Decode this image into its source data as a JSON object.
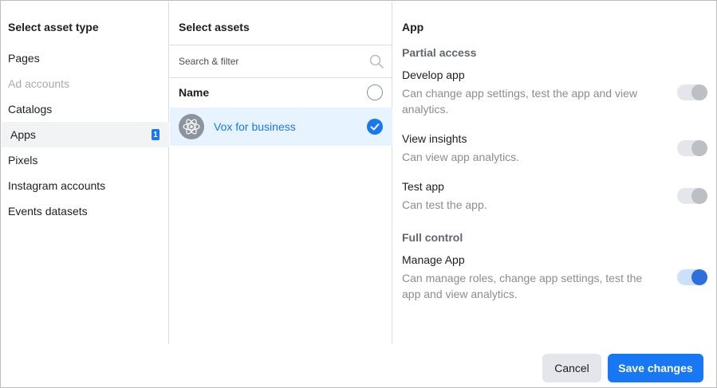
{
  "asset_types": {
    "title": "Select asset type",
    "items": [
      {
        "label": "Pages",
        "state": "normal"
      },
      {
        "label": "Ad accounts",
        "state": "disabled"
      },
      {
        "label": "Catalogs",
        "state": "normal"
      },
      {
        "label": "Apps",
        "state": "selected",
        "badge": "1"
      },
      {
        "label": "Pixels",
        "state": "normal"
      },
      {
        "label": "Instagram accounts",
        "state": "normal"
      },
      {
        "label": "Events datasets",
        "state": "normal"
      }
    ]
  },
  "assets": {
    "title": "Select assets",
    "search_placeholder": "Search & filter",
    "search_value": "",
    "name_header": "Name",
    "rows": [
      {
        "name": "Vox for business",
        "selected": true,
        "icon": "atom-icon"
      }
    ]
  },
  "permissions": {
    "title": "App",
    "partial_title": "Partial access",
    "partial": [
      {
        "title": "Develop app",
        "desc": "Can change app settings, test the app and view analytics.",
        "enabled": false
      },
      {
        "title": "View insights",
        "desc": "Can view app analytics.",
        "enabled": false
      },
      {
        "title": "Test app",
        "desc": "Can test the app.",
        "enabled": false
      }
    ],
    "full_title": "Full control",
    "full": [
      {
        "title": "Manage App",
        "desc": "Can manage roles, change app settings, test the app and view analytics.",
        "enabled": true
      }
    ]
  },
  "footer": {
    "cancel_label": "Cancel",
    "save_label": "Save changes"
  },
  "colors": {
    "accent": "#1877f2",
    "selected_row_bg": "#e7f3ff",
    "toggle_on": "#2d6fdb",
    "toggle_off": "#bcc0c4"
  }
}
